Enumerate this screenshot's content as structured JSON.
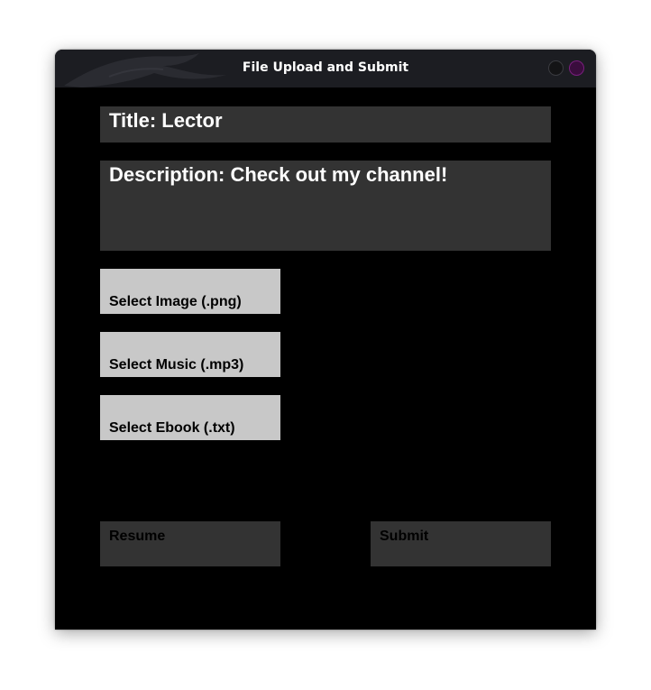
{
  "window": {
    "title": "File Upload and Submit"
  },
  "form": {
    "title_field": "Title: Lector",
    "description_field": "Description: Check out my channel!"
  },
  "file_buttons": {
    "image": "Select Image (.png)",
    "music": "Select Music (.mp3)",
    "ebook": "Select Ebook (.txt)"
  },
  "actions": {
    "resume": "Resume",
    "submit": "Submit"
  },
  "colors": {
    "background": "#000000",
    "titlebar": "#1c1d22",
    "field": "#333333",
    "file_button": "#c8c8c8",
    "close_button": "#7a1f7f"
  },
  "icons": {
    "titlebar_decoration": "dragon-watermark-icon",
    "minimize": "minimize-icon",
    "close": "close-icon"
  }
}
